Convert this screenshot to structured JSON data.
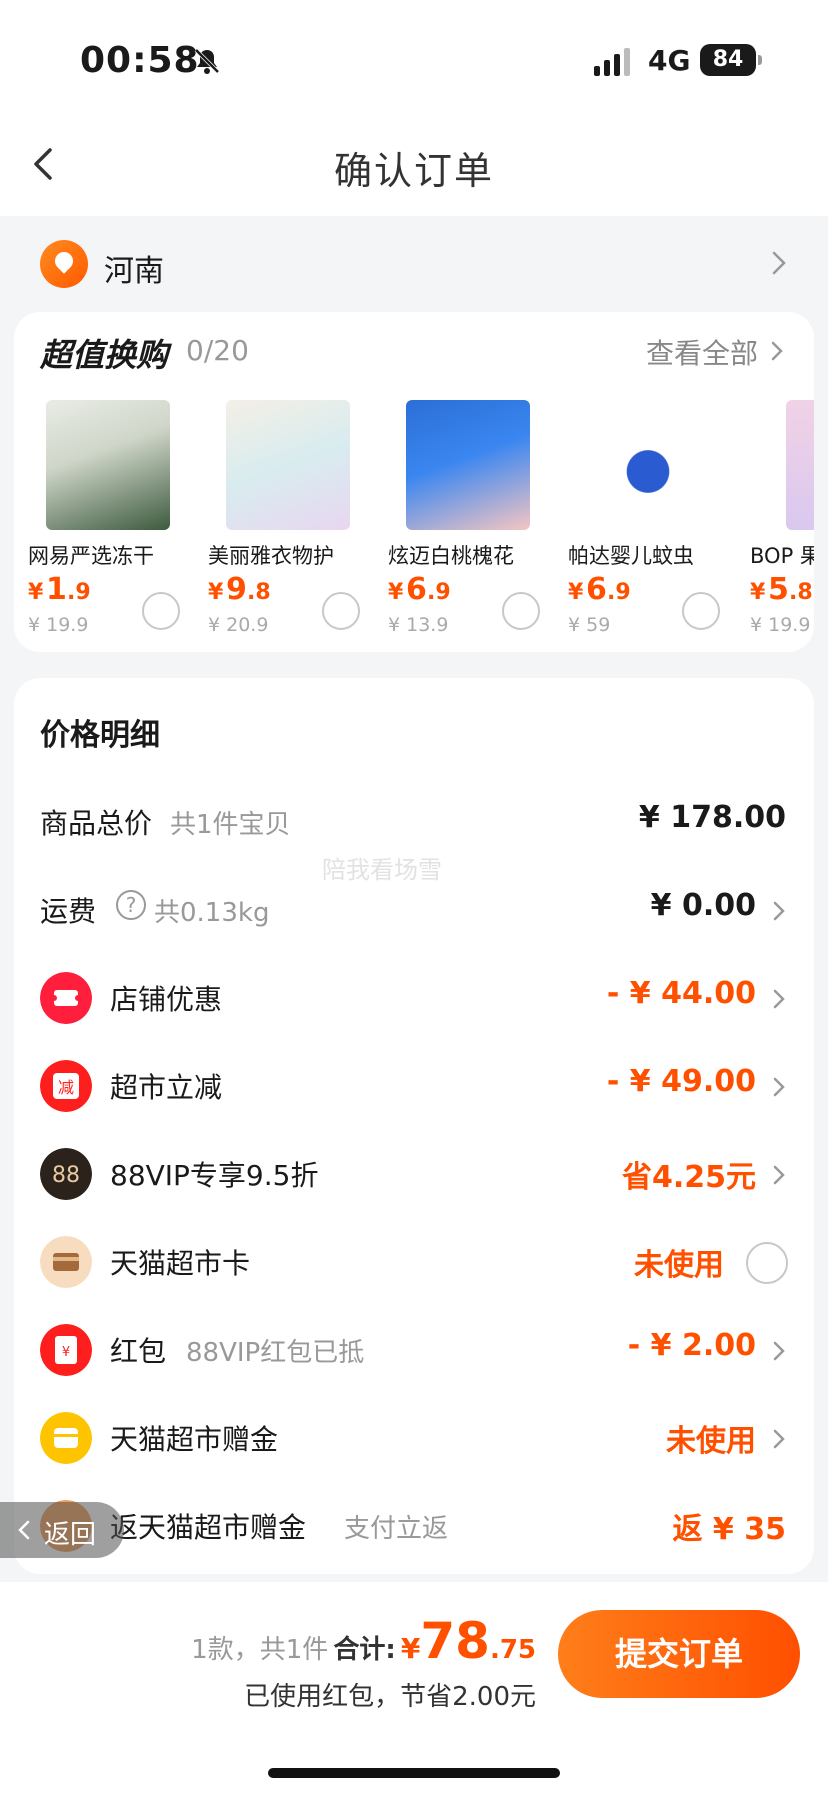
{
  "status": {
    "time": "00:58",
    "network": "4G",
    "battery": "84"
  },
  "nav": {
    "title": "确认订单"
  },
  "address": {
    "text": "河南"
  },
  "exchange": {
    "title": "超值换购",
    "count": "0/20",
    "more": "查看全部",
    "products": [
      {
        "name": "网易严选冻干",
        "yen": "¥",
        "price_int": "1",
        "price_dec": ".9",
        "orig": "¥ 19.9"
      },
      {
        "name": "美丽雅衣物护",
        "yen": "¥",
        "price_int": "9",
        "price_dec": ".8",
        "orig": "¥ 20.9"
      },
      {
        "name": "炫迈白桃槐花",
        "yen": "¥",
        "price_int": "6",
        "price_dec": ".9",
        "orig": "¥ 13.9"
      },
      {
        "name": "帕达婴儿蚊虫",
        "yen": "¥",
        "price_int": "6",
        "price_dec": ".9",
        "orig": "¥ 59"
      },
      {
        "name": "BOP 果",
        "yen": "¥",
        "price_int": "5",
        "price_dec": ".8",
        "orig": "¥ 19.9"
      }
    ]
  },
  "price": {
    "title": "价格明细",
    "rows": [
      {
        "label": "商品总价",
        "sub": "共1件宝贝",
        "value": "¥ 178.00"
      },
      {
        "label": "运费",
        "sub": "共0.13kg",
        "value": "¥ 0.00"
      },
      {
        "label": "店铺优惠",
        "value": "- ¥ 44.00"
      },
      {
        "label": "超市立减",
        "value": "- ¥ 49.00",
        "icon_text": "减"
      },
      {
        "label": "88VIP专享9.5折",
        "value": "省4.25元",
        "icon_text": "88"
      },
      {
        "label": "天猫超市卡",
        "value": "未使用"
      },
      {
        "label": "红包",
        "sub": "88VIP红包已抵",
        "value": "- ¥ 2.00",
        "icon_text": "¥"
      },
      {
        "label": "天猫超市赠金",
        "value": "未使用"
      },
      {
        "label": "返天猫超市赠金",
        "sub": "支付立返",
        "value": "返 ¥ 35"
      }
    ]
  },
  "watermark": "陪我看场雪",
  "back_pill": {
    "label": "返回"
  },
  "footer": {
    "count": "1款，共1件",
    "total_label": "合计:",
    "yen": "¥",
    "total_int": "78",
    "total_dec": ".75",
    "saved": "已使用红包，节省2.00元",
    "submit": "提交订单"
  },
  "colors": {
    "accent": "#ff5000",
    "button_start": "#ff7e1a",
    "button_end": "#ff4f00"
  }
}
